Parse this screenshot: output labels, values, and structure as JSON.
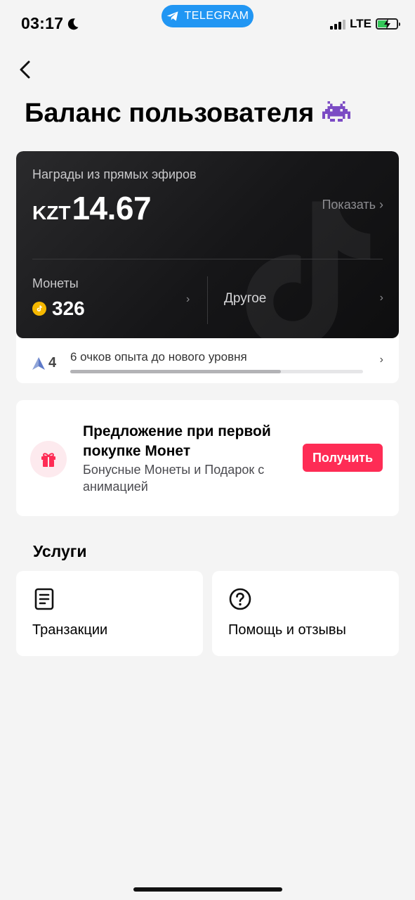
{
  "status_bar": {
    "time": "03:17",
    "pill_label": "TELEGRAM",
    "network": "LTE"
  },
  "header": {
    "title": "Баланс пользователя"
  },
  "balance": {
    "live_rewards_label": "Награды из прямых эфиров",
    "currency": "KZT",
    "amount": "14.67",
    "show_label": "Показать ›",
    "coins_label": "Монеты",
    "coins_value": "326",
    "other_label": "Другое",
    "chevron": "›"
  },
  "xp": {
    "level": "4",
    "text": "6 очков опыта до нового уровня",
    "progress": 0.72,
    "chevron": "›"
  },
  "offer": {
    "title": "Предложение при первой покупке Монет",
    "subtitle": "Бонусные Монеты и Подарок с анимацией",
    "button": "Получить"
  },
  "services": {
    "title": "Услуги",
    "items": [
      {
        "label": "Транзакции",
        "icon": "document-icon"
      },
      {
        "label": "Помощь и отзывы",
        "icon": "help-icon"
      }
    ]
  },
  "colors": {
    "accent": "#fe2c55",
    "telegram": "#2196f3",
    "coin": "#f5b800"
  }
}
